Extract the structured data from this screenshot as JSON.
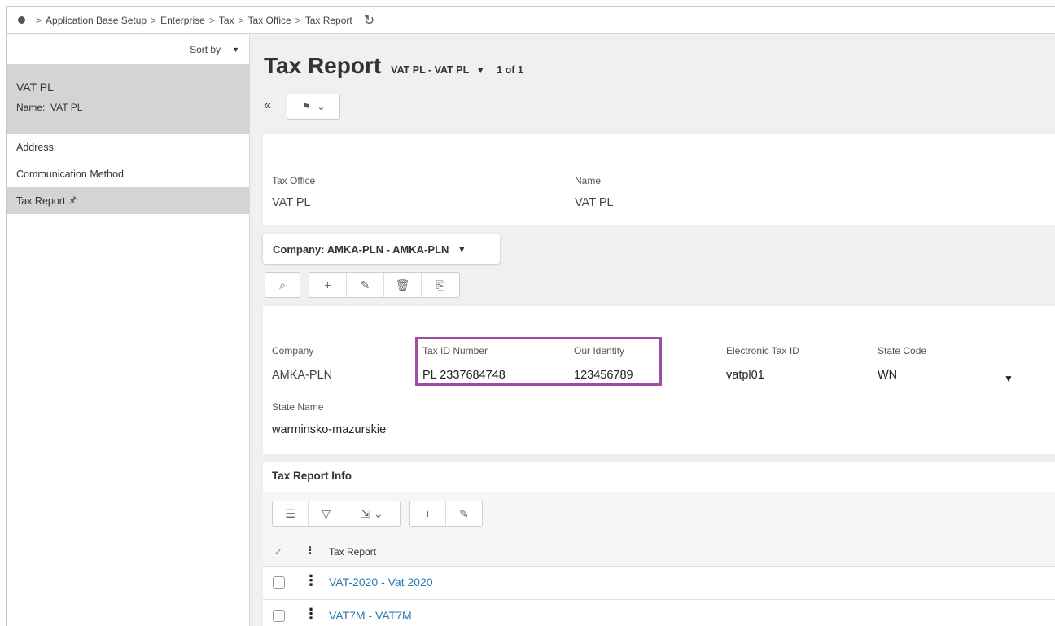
{
  "breadcrumb": {
    "items": [
      "Application Base Setup",
      "Enterprise",
      "Tax",
      "Tax Office",
      "Tax Report"
    ],
    "separator": ">"
  },
  "sidebar": {
    "sort_label": "Sort by",
    "selected": {
      "title": "VAT PL",
      "name_label": "Name:",
      "name_value": "VAT PL"
    },
    "items": [
      {
        "label": "Address"
      },
      {
        "label": "Communication Method"
      },
      {
        "label": "Tax Report"
      }
    ]
  },
  "header": {
    "title": "Tax Report",
    "record": "VAT PL - VAT PL",
    "count": "1 of 1"
  },
  "tax_office_panel": {
    "tax_office_label": "Tax Office",
    "tax_office_value": "VAT PL",
    "name_label": "Name",
    "name_value": "VAT PL"
  },
  "company_selector": {
    "label": "Company: AMKA-PLN - AMKA-PLN"
  },
  "company_panel": {
    "company_label": "Company",
    "company_value": "AMKA-PLN",
    "tax_id_label": "Tax ID Number",
    "tax_id_value": "PL 2337684748",
    "identity_label": "Our Identity",
    "identity_value": "123456789",
    "electronic_label": "Electronic Tax ID",
    "electronic_value": "vatpl01",
    "state_code_label": "State Code",
    "state_code_value": "WN",
    "state_name_label": "State Name",
    "state_name_value": "warminsko-mazurskie"
  },
  "tax_report_info": {
    "title": "Tax Report Info",
    "column_header": "Tax Report",
    "rows": [
      {
        "label": "VAT-2020 - Vat 2020"
      },
      {
        "label": "VAT7M - VAT7M"
      }
    ]
  },
  "colors": {
    "highlight": "#9b4f9e",
    "link": "#2a7ab0",
    "selected_bg": "#d4d4d4"
  }
}
